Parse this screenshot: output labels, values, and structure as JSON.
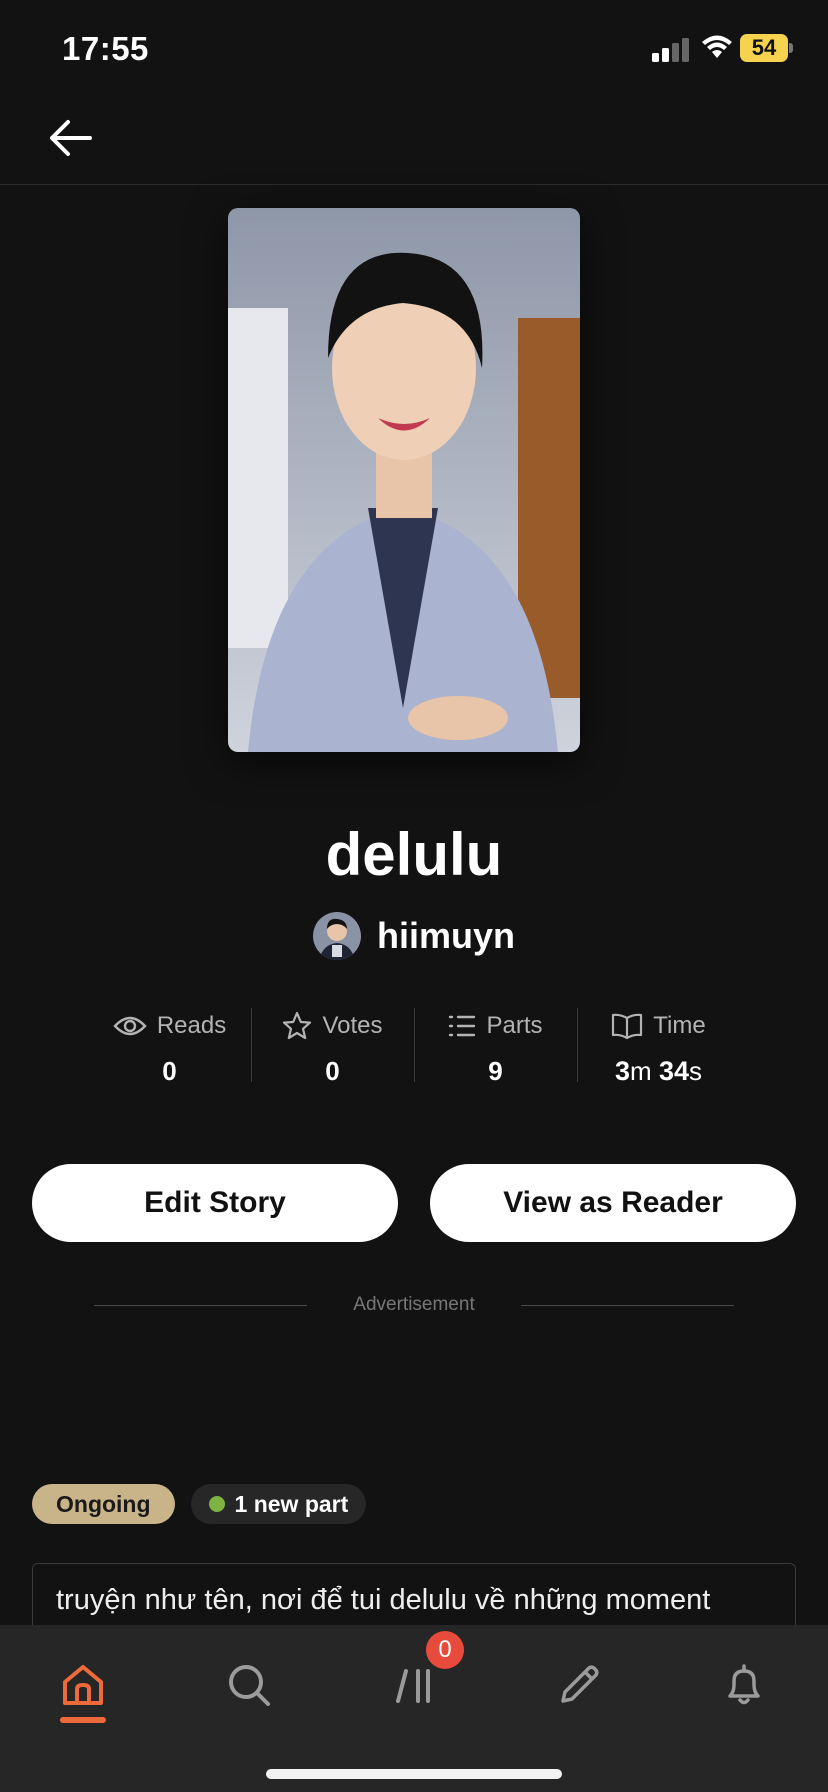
{
  "status_bar": {
    "time": "17:55",
    "battery": "54"
  },
  "story": {
    "title": "delulu",
    "author": "hiimuyn"
  },
  "stats": [
    {
      "label": "Reads",
      "value": "0",
      "icon": "eye-icon"
    },
    {
      "label": "Votes",
      "value": "0",
      "icon": "star-icon"
    },
    {
      "label": "Parts",
      "value": "9",
      "icon": "list-icon"
    },
    {
      "label": "Time",
      "icon": "book-icon",
      "time": {
        "minutes": "3",
        "m": "m",
        "seconds": "34",
        "s": "s"
      }
    }
  ],
  "actions": {
    "edit": "Edit Story",
    "view_as_reader": "View as Reader"
  },
  "ad": {
    "label": "Advertisement"
  },
  "badges": {
    "status": "Ongoing",
    "new_part": "1 new part"
  },
  "description": "truyện như tên, nơi để tui delulu về những moment",
  "bottom_nav": {
    "items": [
      "home-icon",
      "search-icon",
      "library-icon",
      "pencil-icon",
      "bell-icon"
    ],
    "library_badge": "0",
    "active": "home",
    "accent_color": "#ef6a3a"
  }
}
